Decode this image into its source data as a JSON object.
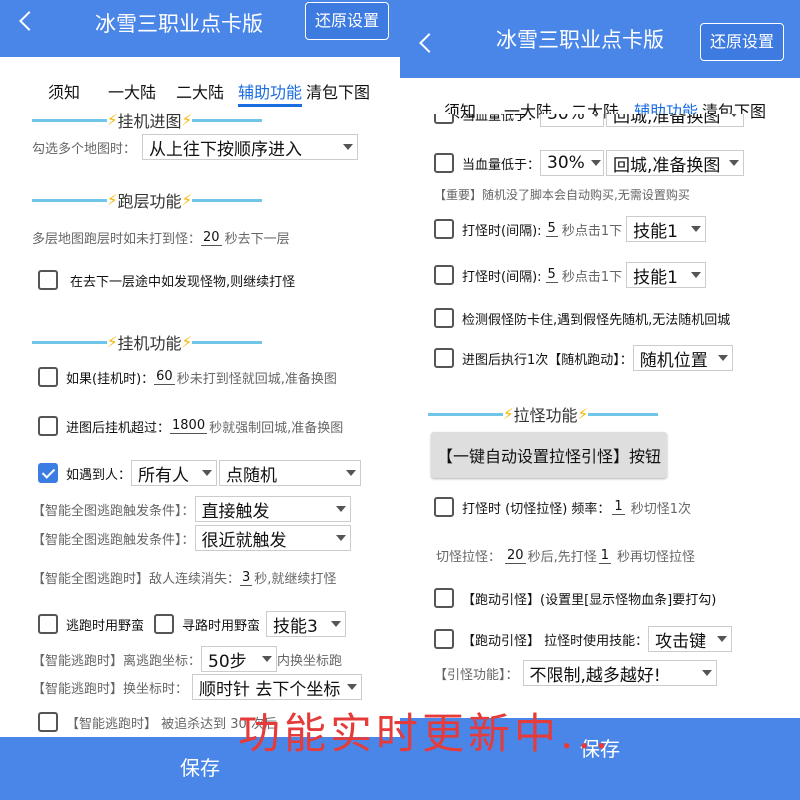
{
  "title": "冰雪三职业点卡版",
  "reset_label": "还原设置",
  "save_label": "保存",
  "tabs": [
    "须知",
    "一大陆",
    "二大陆",
    "辅助功能",
    "清包下图"
  ],
  "left": {
    "sec_hang_enter": "挂机进图",
    "multi_map_label": "勾选多个地图时：",
    "multi_map_value": "从上往下按顺序进入",
    "sec_layer": "跑层功能",
    "layer_label_a": "多层地图跑层时如未打到怪：",
    "layer_num": "20",
    "layer_label_b": "秒去下一层",
    "layer_check": "在去下一层途中如发现怪物,则继续打怪",
    "sec_hang": "挂机功能",
    "if_label": "如果(挂机时)：",
    "if_num": "60",
    "if_tail": "秒未打到怪就回城,准备换图",
    "enter_label": "进图后挂机超过：",
    "enter_num": "1800",
    "enter_tail": "秒就强制回城,准备换图",
    "meet_label": "如遇到人：",
    "meet_sel1": "所有人",
    "meet_sel2": "点随机",
    "cond1_label": "【智能全图逃跑触发条件】：",
    "cond1_value": "直接触发",
    "cond2_label": "【智能全图逃跑触发条件】：",
    "cond2_value": "很近就触发",
    "esc_label_a": "【智能全图逃跑时】敌人连续消失：",
    "esc_num": "3",
    "esc_label_b": "秒,就继续打怪",
    "wild_label": "逃跑时用野蛮",
    "path_label": "寻路时用野蛮",
    "skill3": "技能3",
    "coord_label": "【智能逃跑时】离逃跑坐标：",
    "coord_value": "50步",
    "coord_tail": "内换坐标跑",
    "switch_label": "【智能逃跑时】换坐标时：",
    "switch_value": "顺时针 去下个坐标",
    "cut_label": "【智能逃跑时】 被追杀达到   30   次后"
  },
  "right": {
    "hp_cut": "当血量低于：",
    "hp_cut_val": "30%",
    "hp_cut_sel": "回城,准备换图",
    "hp_label": "当血量低于：",
    "hp_val": "30%",
    "hp_sel": "回城,准备换图",
    "notice": "【重要】随机没了脚本会自动购买,无需设置购买",
    "hit1_label": "打怪时(间隔):",
    "hit1_num": "5",
    "hit1_tail": "秒点击1下",
    "hit1_sel": "技能1",
    "hit2_label": "打怪时(间隔):",
    "hit2_num": "5",
    "hit2_tail": "秒点击1下",
    "hit2_sel": "技能1",
    "fake_label": "检测假怪防卡住,遇到假怪先随机,无法随机回城",
    "enter_label": "进图后执行1次【随机跑动】：",
    "enter_sel": "随机位置",
    "sec_pull": "拉怪功能",
    "pull_btn": "【一键自动设置拉怪引怪】按钮",
    "freq_label": "打怪时 (切怪拉怪) 频率：",
    "freq_num": "1",
    "freq_tail": "秒切怪1次",
    "cut_a": "切怪拉怪：",
    "cut_num1": "20",
    "cut_b": "秒后,先打怪",
    "cut_num2": "1",
    "cut_c": "秒再切怪拉怪",
    "run_pull": "【跑动引怪】(设置里[显示怪物血条]要打勾)",
    "run_skill_label": "【跑动引怪】 拉怪时使用技能：",
    "run_skill_sel": "攻击键",
    "lure_label": "【引怪功能】：",
    "lure_sel": "不限制,越多越好!"
  },
  "overlay_text": "功能实时更新中..."
}
